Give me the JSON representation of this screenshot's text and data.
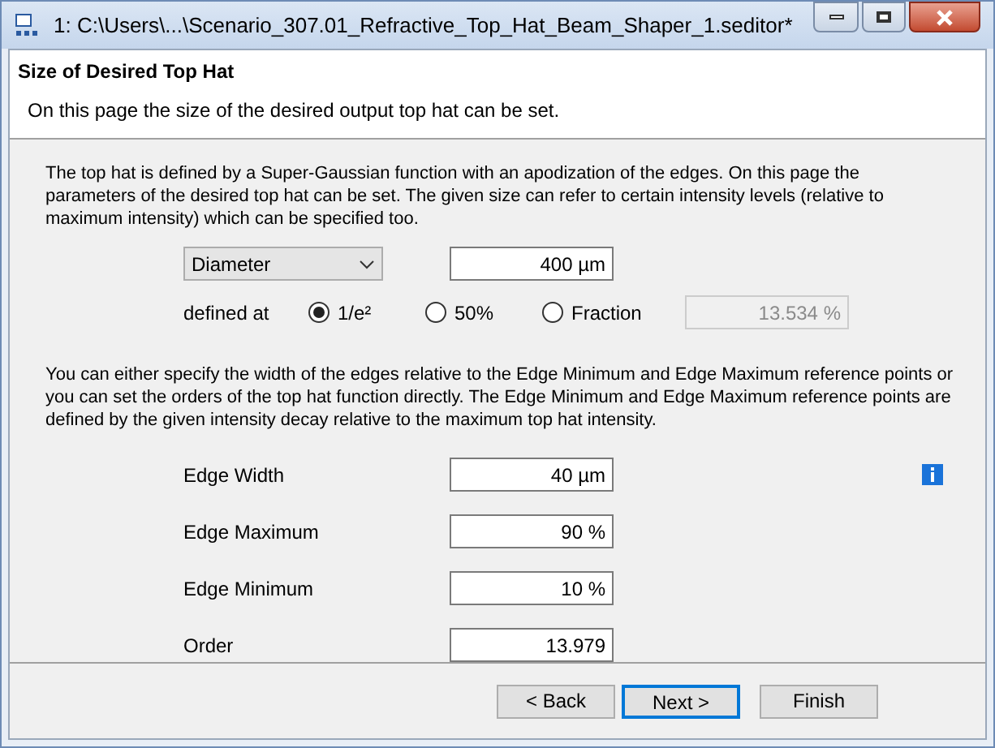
{
  "window": {
    "title": "1: C:\\Users\\...\\Scenario_307.01_Refractive_Top_Hat_Beam_Shaper_1.seditor*"
  },
  "header": {
    "title": "Size of Desired Top Hat",
    "subtitle": "On this page the size of the desired output top hat can be set."
  },
  "intro": "The top hat is defined by a Super-Gaussian function with an apodization of the edges. On this page the parameters of the desired top hat can be set. The given size can refer to certain intensity levels (relative to maximum intensity) which can be specified too.",
  "size": {
    "measure": "Diameter",
    "value": "400 µm"
  },
  "defined_at": {
    "label": "defined at",
    "options": [
      {
        "label": "1/e²",
        "selected": true
      },
      {
        "label": "50%",
        "selected": false
      },
      {
        "label": "Fraction",
        "selected": false
      }
    ],
    "fraction_value": "13.534 %",
    "fraction_disabled": true
  },
  "edges_text": "You can either specify the width of the edges relative to the Edge Minimum and Edge Maximum reference points or you can set the orders of the top hat function directly. The Edge Minimum and Edge Maximum reference points are defined by the given intensity decay relative to the maximum top hat intensity.",
  "parameters": [
    {
      "label": "Edge Width",
      "value": "40 µm"
    },
    {
      "label": "Edge Maximum",
      "value": "90 %"
    },
    {
      "label": "Edge Minimum",
      "value": "10 %"
    },
    {
      "label": "Order",
      "value": "13.979"
    }
  ],
  "buttons": [
    {
      "label": "< Back",
      "default": false
    },
    {
      "label": "Next >",
      "default": true
    },
    {
      "label": "Finish",
      "default": false
    }
  ]
}
